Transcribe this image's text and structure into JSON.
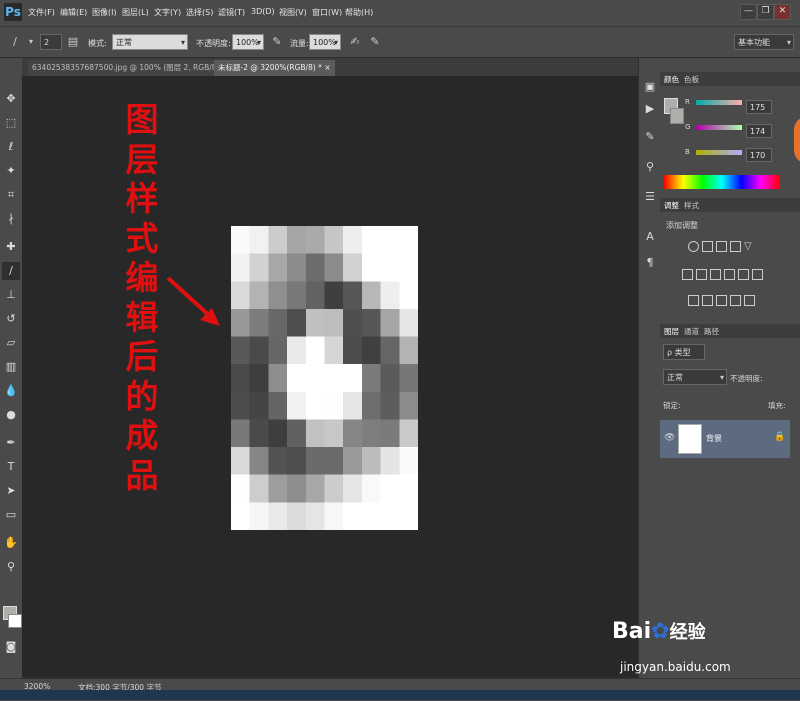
{
  "app": {
    "logo": "Ps"
  },
  "menu": [
    "文件(F)",
    "编辑(E)",
    "图像(I)",
    "图层(L)",
    "文字(Y)",
    "选择(S)",
    "滤镜(T)",
    "3D(D)",
    "视图(V)",
    "窗口(W)",
    "帮助(H)"
  ],
  "window_buttons": [
    "—",
    "❐",
    "✕"
  ],
  "options": {
    "brush_size": "2",
    "mode_label": "模式:",
    "mode_value": "正常",
    "opacity_label": "不透明度:",
    "opacity_value": "100%",
    "flow_label": "流量:",
    "flow_value": "100%",
    "workspace": "基本功能"
  },
  "tabs": [
    {
      "label": "63402538357687500.jpg @ 100% (图层 2, RGB/8#) *",
      "close": "×"
    },
    {
      "label": "未标题-2 @ 3200%(RGB/8) *",
      "close": "×"
    }
  ],
  "annotation": {
    "text": "图层样式编辑后的成品",
    "color": "#e01010"
  },
  "color_panel": {
    "tabs": [
      "颜色",
      "色板"
    ],
    "r_label": "R",
    "r_value": "175",
    "g_label": "G",
    "g_value": "174",
    "b_label": "B",
    "b_value": "170"
  },
  "adjust_panel": {
    "tabs": [
      "调整",
      "样式"
    ],
    "title": "添加调整"
  },
  "layers_panel": {
    "tabs": [
      "图层",
      "通道",
      "路径"
    ],
    "filter_label": "ρ 类型",
    "blend_mode": "正常",
    "opacity_label": "不透明度:",
    "lock_label": "锁定:",
    "fill_label": "填充:",
    "layer_name": "背景"
  },
  "status": {
    "zoom": "3200%",
    "doc_info": "文档:300 字节/300 字节"
  },
  "watermark": {
    "brand": "Bai",
    "brand_cn": "经验",
    "url": "jingyan.baidu.com"
  },
  "canvas_pixels": [
    [
      "#fafafa",
      "#f1f1f1",
      "#cccccc",
      "#a6a6a6",
      "#aaaaaa",
      "#c6c6c6",
      "#eeeeee",
      "#ffffff",
      "#ffffff",
      "#ffffff"
    ],
    [
      "#f2f2f2",
      "#d2d2d2",
      "#a7a7a7",
      "#8c8c8c",
      "#6c6c6c",
      "#8b8b8b",
      "#d1d1d1",
      "#ffffff",
      "#ffffff",
      "#ffffff"
    ],
    [
      "#dadada",
      "#b3b3b3",
      "#8f8f8f",
      "#787878",
      "#626262",
      "#3f3f3f",
      "#565656",
      "#b7b7b7",
      "#eeeeee",
      "#ffffff"
    ],
    [
      "#989898",
      "#7c7c7c",
      "#686868",
      "#4e4e4e",
      "#c0c0c0",
      "#bdbdbd",
      "#4f4f4f",
      "#575757",
      "#a5a5a5",
      "#e6e6e6"
    ],
    [
      "#595959",
      "#4a4a4a",
      "#666666",
      "#eaeaea",
      "#ffffff",
      "#d6d6d6",
      "#4c4c4c",
      "#404040",
      "#666666",
      "#b3b3b3"
    ],
    [
      "#4a4a4a",
      "#3e3e3e",
      "#8e8e8e",
      "#ffffff",
      "#ffffff",
      "#ffffff",
      "#ffffff",
      "#7b7b7b",
      "#5b5b5b",
      "#777777"
    ],
    [
      "#4d4d4d",
      "#454545",
      "#656565",
      "#f1f1f1",
      "#ffffff",
      "#fefefe",
      "#e5e5e5",
      "#6e6e6e",
      "#5d5d5d",
      "#8c8c8c"
    ],
    [
      "#787878",
      "#4a4a4a",
      "#3e3e3e",
      "#616161",
      "#c1c1c1",
      "#c7c7c7",
      "#868686",
      "#7e7e7e",
      "#7b7b7b",
      "#c9c9c9"
    ],
    [
      "#dadada",
      "#858585",
      "#525252",
      "#4e4e4e",
      "#6b6b6b",
      "#6a6a6a",
      "#9a9a9a",
      "#bcbcbc",
      "#e4e4e4",
      "#fafafa"
    ],
    [
      "#fdfdfd",
      "#cdcdcd",
      "#9d9d9d",
      "#8e8e8e",
      "#a7a7a7",
      "#cccccc",
      "#e6e6e6",
      "#f9f9f9",
      "#ffffff",
      "#ffffff"
    ],
    [
      "#ffffff",
      "#f6f6f6",
      "#e9e9e9",
      "#dbdbdb",
      "#e5e5e5",
      "#f7f7f7",
      "#ffffff",
      "#ffffff",
      "#ffffff",
      "#ffffff"
    ]
  ],
  "colors": {
    "foreground": "#afaeaa",
    "background": "#ffffff",
    "accent": "#e8712a"
  }
}
